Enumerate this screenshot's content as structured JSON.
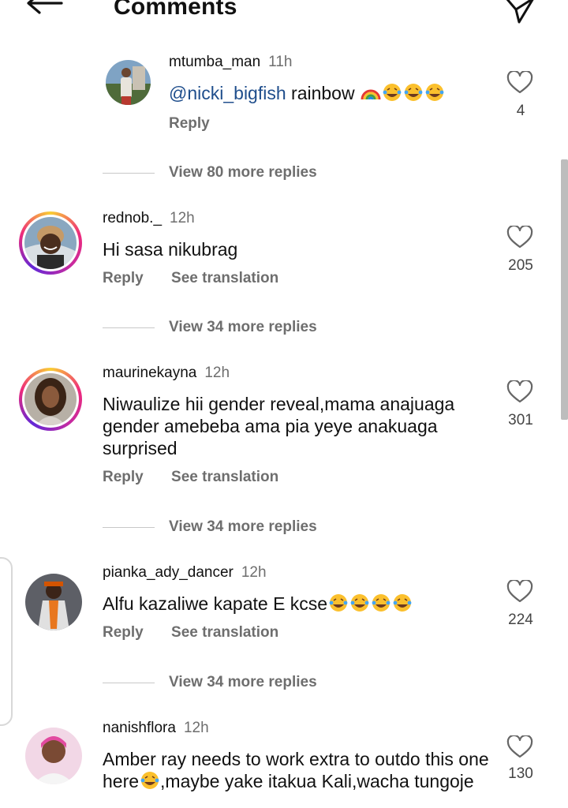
{
  "header": {
    "title": "Comments",
    "back_icon": "arrow-left-icon",
    "send_icon": "paper-plane-icon"
  },
  "comments": [
    {
      "username": "mtumba_man",
      "time": "11h",
      "mention": "@nicki_bigfish",
      "text": " rainbow ",
      "emojis": [
        "rainbow",
        "joy",
        "joy",
        "joy"
      ],
      "reply_label": "Reply",
      "likes": "4",
      "view_replies": "View 80 more replies"
    },
    {
      "username": "rednob._",
      "time": "12h",
      "text": "Hi sasa nikubrag",
      "reply_label": "Reply",
      "translation_label": "See translation",
      "likes": "205",
      "view_replies": "View 34 more replies"
    },
    {
      "username": "maurinekayna",
      "time": "12h",
      "text": "Niwaulize hii gender reveal,mama anajuaga gender amebeba ama pia yeye anakuaga surprised",
      "reply_label": "Reply",
      "translation_label": "See translation",
      "likes": "301",
      "view_replies": "View 34 more replies"
    },
    {
      "username": "pianka_ady_dancer",
      "time": "12h",
      "text": "Alfu kazaliwe kapate E kcse",
      "emojis": [
        "joy",
        "joy",
        "joy",
        "joy"
      ],
      "reply_label": "Reply",
      "translation_label": "See translation",
      "likes": "224",
      "view_replies": "View 34 more replies"
    },
    {
      "username": "nanishflora",
      "time": "12h",
      "text_part1": "Amber ray needs to work extra to outdo this one here",
      "text_part2": ",maybe yake itakua Kali,wacha tungoje",
      "likes": "130"
    }
  ],
  "colors": {
    "mention": "#1f4e8c",
    "muted": "#6e6e6e",
    "story_ring": "#ee2a7b"
  }
}
